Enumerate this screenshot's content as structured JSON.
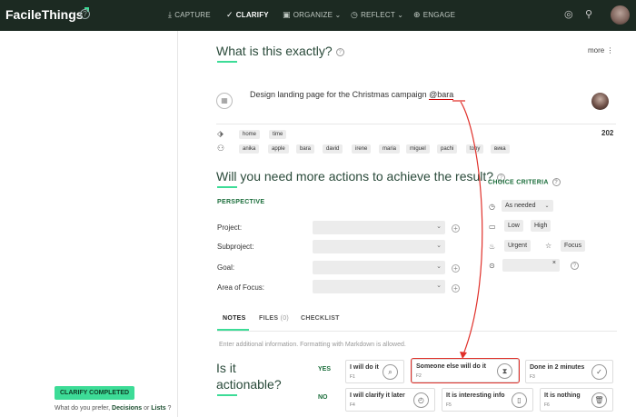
{
  "app": {
    "title": "FacileThings"
  },
  "nav": [
    {
      "label": "CAPTURE",
      "icon": "capture-icon",
      "glyph": "⤓"
    },
    {
      "label": "CLARIFY",
      "icon": "clarify-icon",
      "glyph": "✓"
    },
    {
      "label": "ORGANIZE",
      "icon": "organize-icon",
      "glyph": "▣",
      "dropdown": "⌄"
    },
    {
      "label": "REFLECT",
      "icon": "reflect-icon",
      "glyph": "◷",
      "dropdown": "⌄"
    },
    {
      "label": "ENGAGE",
      "icon": "engage-icon",
      "glyph": "⊕"
    }
  ],
  "header": {
    "title": "What is this exactly?",
    "more": "more"
  },
  "task": {
    "text": "Design landing page for the Christmas campaign ",
    "mention": "@bara"
  },
  "tags": [
    "home",
    "time"
  ],
  "people": [
    "anika",
    "apple",
    "bara",
    "david",
    "irene",
    "maria",
    "miguel",
    "pachi",
    "tony",
    "вика"
  ],
  "right_number": "202",
  "actions_title": "Will you need more actions to achieve the result?",
  "perspective": {
    "label": "PERSPECTIVE",
    "fields": [
      "Project:",
      "Subproject:",
      "Goal:",
      "Area of Focus:"
    ]
  },
  "criteria": {
    "label": "CHOICE CRITERIA",
    "time": "As needed",
    "energy": [
      "Low",
      "High"
    ],
    "urgent": "Urgent",
    "focus": "Focus",
    "clear": "×"
  },
  "tabs": [
    {
      "label": "NOTES",
      "count": ""
    },
    {
      "label": "FILES",
      "count": "(0)"
    },
    {
      "label": "CHECKLIST",
      "count": ""
    }
  ],
  "notes_placeholder": "Enter additional information. Formatting with Markdown is allowed.",
  "actionable": {
    "title": "Is it actionable?",
    "yes": "YES",
    "no": "NO",
    "yes_options": [
      {
        "label": "I will do it",
        "key": "F1",
        "icon": "do-it-icon",
        "glyph": "⌕"
      },
      {
        "label": "Someone else will do it",
        "key": "F2",
        "icon": "hourglass-icon",
        "glyph": "⧗"
      },
      {
        "label": "Done in 2 minutes",
        "key": "F3",
        "icon": "check-icon",
        "glyph": "✓"
      }
    ],
    "no_options": [
      {
        "label": "I will clarify it later",
        "key": "F4",
        "icon": "clock-icon",
        "glyph": "◴"
      },
      {
        "label": "It is interesting info",
        "key": "F5",
        "icon": "bookmark-icon",
        "glyph": "▯"
      },
      {
        "label": "It is nothing",
        "key": "F6",
        "icon": "trash-icon",
        "glyph": "🗑"
      }
    ]
  },
  "sidebar": {
    "badge": "CLARIFY COMPLETED",
    "prefer_text": "What do you prefer, ",
    "decisions": "Decisions",
    "or": " or ",
    "lists": "Lists",
    "q": " ?"
  },
  "colors": {
    "accent": "#3ddc97",
    "topbar": "#1c2a22",
    "highlight": "#e0302a"
  }
}
